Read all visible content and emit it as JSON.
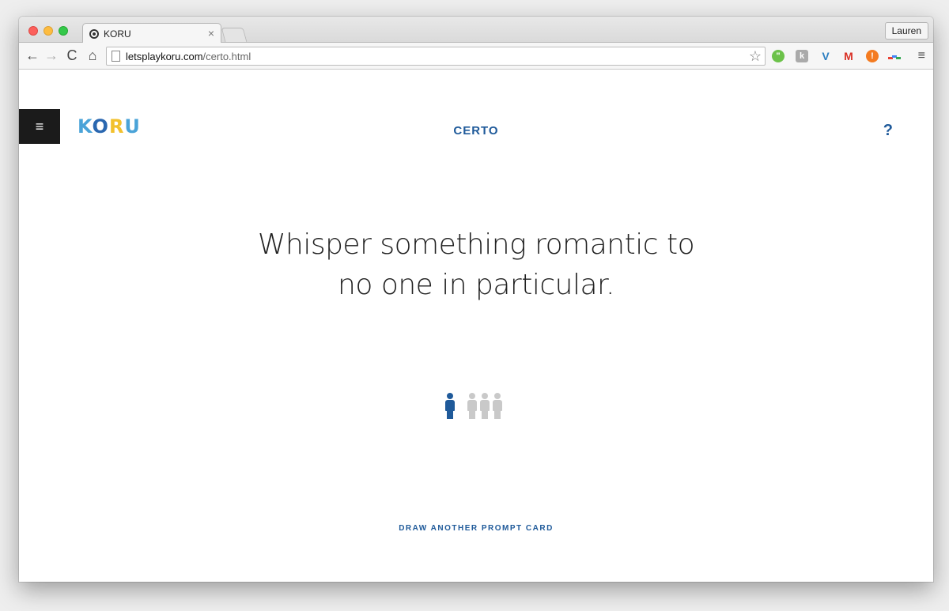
{
  "browser": {
    "tab_title": "KORU",
    "tab_close": "×",
    "profile_name": "Lauren",
    "url_host": "letsplaykoru.com",
    "url_path": "/certo.html",
    "icons": {
      "back": "←",
      "forward": "→",
      "reload": "C",
      "home": "⌂",
      "star": "☆",
      "menu": "≡"
    }
  },
  "page": {
    "menu_icon": "≡",
    "logo": {
      "k": "K",
      "o": "O",
      "r": "R",
      "u": "U"
    },
    "title": "CERTO",
    "help": "?",
    "prompt_line1": "Whisper something romantic to",
    "prompt_line2": "no one in particular.",
    "people": {
      "active_count": 1,
      "total": 4
    },
    "draw_link": "DRAW ANOTHER PROMPT CARD"
  },
  "colors": {
    "accent": "#1f5a9a",
    "inactive_person": "#c9c9c9",
    "menu_bg": "#1b1b1b"
  }
}
